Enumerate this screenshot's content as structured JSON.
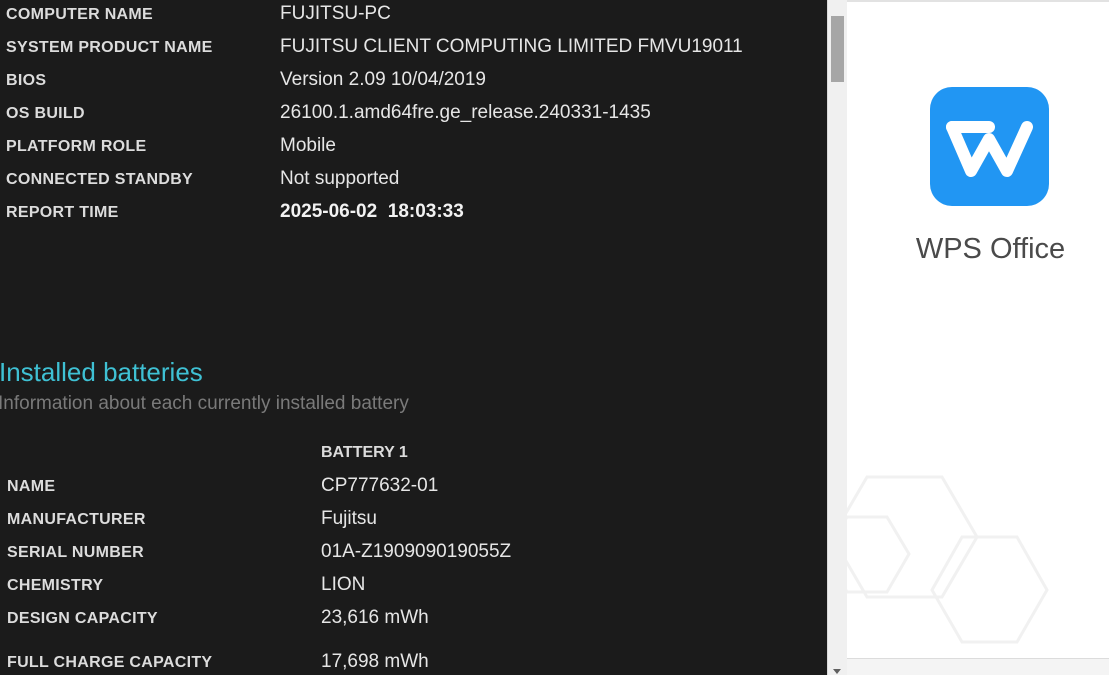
{
  "system_info": [
    {
      "label": "COMPUTER NAME",
      "value": "FUJITSU-PC"
    },
    {
      "label": "SYSTEM PRODUCT NAME",
      "value": "FUJITSU CLIENT COMPUTING LIMITED FMVU19011"
    },
    {
      "label": "BIOS",
      "value": "Version 2.09 10/04/2019"
    },
    {
      "label": "OS BUILD",
      "value": "26100.1.amd64fre.ge_release.240331-1435"
    },
    {
      "label": "PLATFORM ROLE",
      "value": "Mobile"
    },
    {
      "label": "CONNECTED STANDBY",
      "value": "Not supported"
    },
    {
      "label": "REPORT TIME",
      "value": "2025-06-02  18:03:33"
    }
  ],
  "installed_batteries": {
    "title": "Installed batteries",
    "description": "Information about each currently installed battery",
    "column_header": "BATTERY 1",
    "rows": [
      {
        "label": "NAME",
        "value": "CP777632-01"
      },
      {
        "label": "MANUFACTURER",
        "value": "Fujitsu"
      },
      {
        "label": "SERIAL NUMBER",
        "value": "01A-Z190909019055Z"
      },
      {
        "label": "CHEMISTRY",
        "value": "LION"
      },
      {
        "label": "DESIGN CAPACITY",
        "value": "23,616 mWh"
      },
      {
        "label": "FULL CHARGE CAPACITY",
        "value": "17,698 mWh"
      }
    ]
  },
  "splash": {
    "app_name": "WPS Office",
    "icon": "wps-logo-icon",
    "brand_color": "#2196f3"
  },
  "colors": {
    "background": "#1b1b1b",
    "section_title": "#3fc1d4"
  }
}
